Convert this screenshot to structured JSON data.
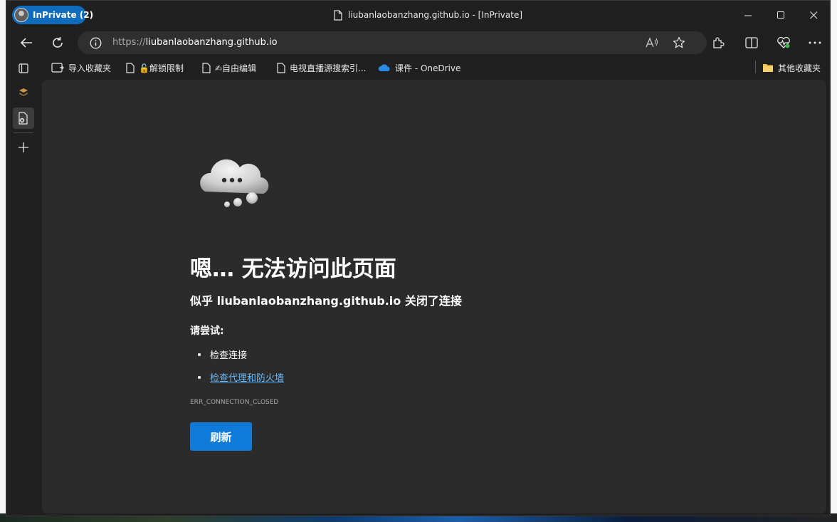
{
  "browser": {
    "profile_label": "InPrivate (2)",
    "tab_title": "liubanlaobanzhang.github.io - [InPrivate]",
    "url_scheme": "https://",
    "url_host": "liubanlaobanzhang.github.io"
  },
  "favorites": [
    {
      "label": "导入收藏夹",
      "icon": "import-favorites-icon"
    },
    {
      "label": "🔓解锁限制",
      "icon": "page-icon"
    },
    {
      "label": "✍自由编辑",
      "icon": "page-icon"
    },
    {
      "label": "电视直播源搜索引...",
      "icon": "page-icon"
    },
    {
      "label": "课件 - OneDrive",
      "icon": "onedrive-icon"
    }
  ],
  "other_favorites": "其他收藏夹",
  "error_page": {
    "title": "嗯… 无法访问此页面",
    "subtitle": "似乎 liubanlaobanzhang.github.io 关闭了连接",
    "try_heading": "请尝试:",
    "suggestions": [
      "检查连接",
      "检查代理和防火墙"
    ],
    "error_code": "ERR_CONNECTION_CLOSED",
    "refresh_label": "刷新"
  },
  "colors": {
    "accent": "#0f7ad8",
    "link": "#6cb8f6",
    "content_bg": "#2b2b2b",
    "chrome_bg": "#202020"
  }
}
